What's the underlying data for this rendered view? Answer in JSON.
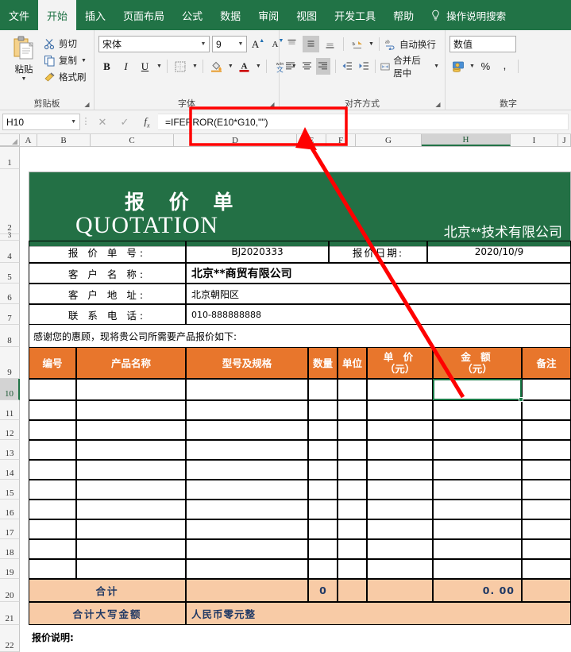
{
  "ribbon": {
    "tabs": [
      {
        "label": "文件",
        "active": false
      },
      {
        "label": "开始",
        "active": true
      },
      {
        "label": "插入",
        "active": false
      },
      {
        "label": "页面布局",
        "active": false
      },
      {
        "label": "公式",
        "active": false
      },
      {
        "label": "数据",
        "active": false
      },
      {
        "label": "审阅",
        "active": false
      },
      {
        "label": "视图",
        "active": false
      },
      {
        "label": "开发工具",
        "active": false
      },
      {
        "label": "帮助",
        "active": false
      }
    ],
    "tellme": "操作说明搜索",
    "tellme_icon": "lightbulb-icon",
    "groups": {
      "clipboard": {
        "name": "剪贴板",
        "paste": "粘贴",
        "cut": "剪切",
        "copy": "复制",
        "format_painter": "格式刷"
      },
      "font": {
        "name": "字体",
        "font_family": "宋体",
        "font_size": "9",
        "bold": "B",
        "italic": "I",
        "underline": "U",
        "grow_font": "A",
        "shrink_font": "A",
        "phonetic": "文"
      },
      "alignment": {
        "name": "对齐方式",
        "wrap_text": "自动换行",
        "merge_center": "合并后居中"
      },
      "number": {
        "name": "数字",
        "format": "数值",
        "percent": "%",
        "comma": ","
      }
    }
  },
  "formula_bar": {
    "name_box": "H10",
    "cancel_icon": "cancel-icon",
    "enter_icon": "confirm-icon",
    "fx_icon": "insert-function-icon",
    "formula": "=IFERROR(E10*G10,\"\")"
  },
  "grid": {
    "columns": [
      "A",
      "B",
      "C",
      "D",
      "E",
      "F",
      "G",
      "H",
      "I",
      "J"
    ],
    "selected_column": "H",
    "selected_row": "10",
    "rows": [
      "1",
      "2",
      "3",
      "4",
      "5",
      "6",
      "7",
      "8",
      "9",
      "10",
      "11",
      "12",
      "13",
      "14",
      "15",
      "16",
      "17",
      "18",
      "19",
      "20",
      "21",
      "22"
    ]
  },
  "document": {
    "banner": {
      "title_cn": "报 价 单",
      "title_en": "QUOTATION",
      "company": "北京**技术有限公司"
    },
    "info": [
      {
        "label": "报 价 单 号:",
        "value": "BJ2020333",
        "label2": "报价日期:",
        "value2": "2020/10/9"
      },
      {
        "label": "客 户 名 称:",
        "value": "北京**商贸有限公司"
      },
      {
        "label": "客 户 地 址:",
        "value": "北京朝阳区"
      },
      {
        "label": "联 系 电 话:",
        "value": "010-888888888"
      }
    ],
    "thanks": "感谢您的惠顾，现将贵公司所需要产品报价如下:",
    "table_headers": [
      {
        "line1": "编号",
        "line2": ""
      },
      {
        "line1": "产品名称",
        "line2": ""
      },
      {
        "line1": "型号及规格",
        "line2": ""
      },
      {
        "line1": "数量",
        "line2": ""
      },
      {
        "line1": "单位",
        "line2": ""
      },
      {
        "line1": "单 价",
        "line2": "（元）"
      },
      {
        "line1": "金 额",
        "line2": "（元）"
      },
      {
        "line1": "备注",
        "line2": ""
      }
    ],
    "empty_row_count": 10,
    "total_row": {
      "label": "合计",
      "qty": "0",
      "amount": "0. 00"
    },
    "capital_row": {
      "label": "合计大写金额",
      "value": "人民币零元整"
    },
    "footer_note": "报价说明:"
  },
  "annotation": {
    "highlight_color": "#FF0000",
    "target": "formula-bar",
    "points_to": "H10"
  },
  "colors": {
    "ribbon_green": "#217346",
    "banner_green": "#237045",
    "table_header_orange": "#E8762C",
    "total_row_peach": "#F8CBA6",
    "total_text_navy": "#1F3864"
  }
}
